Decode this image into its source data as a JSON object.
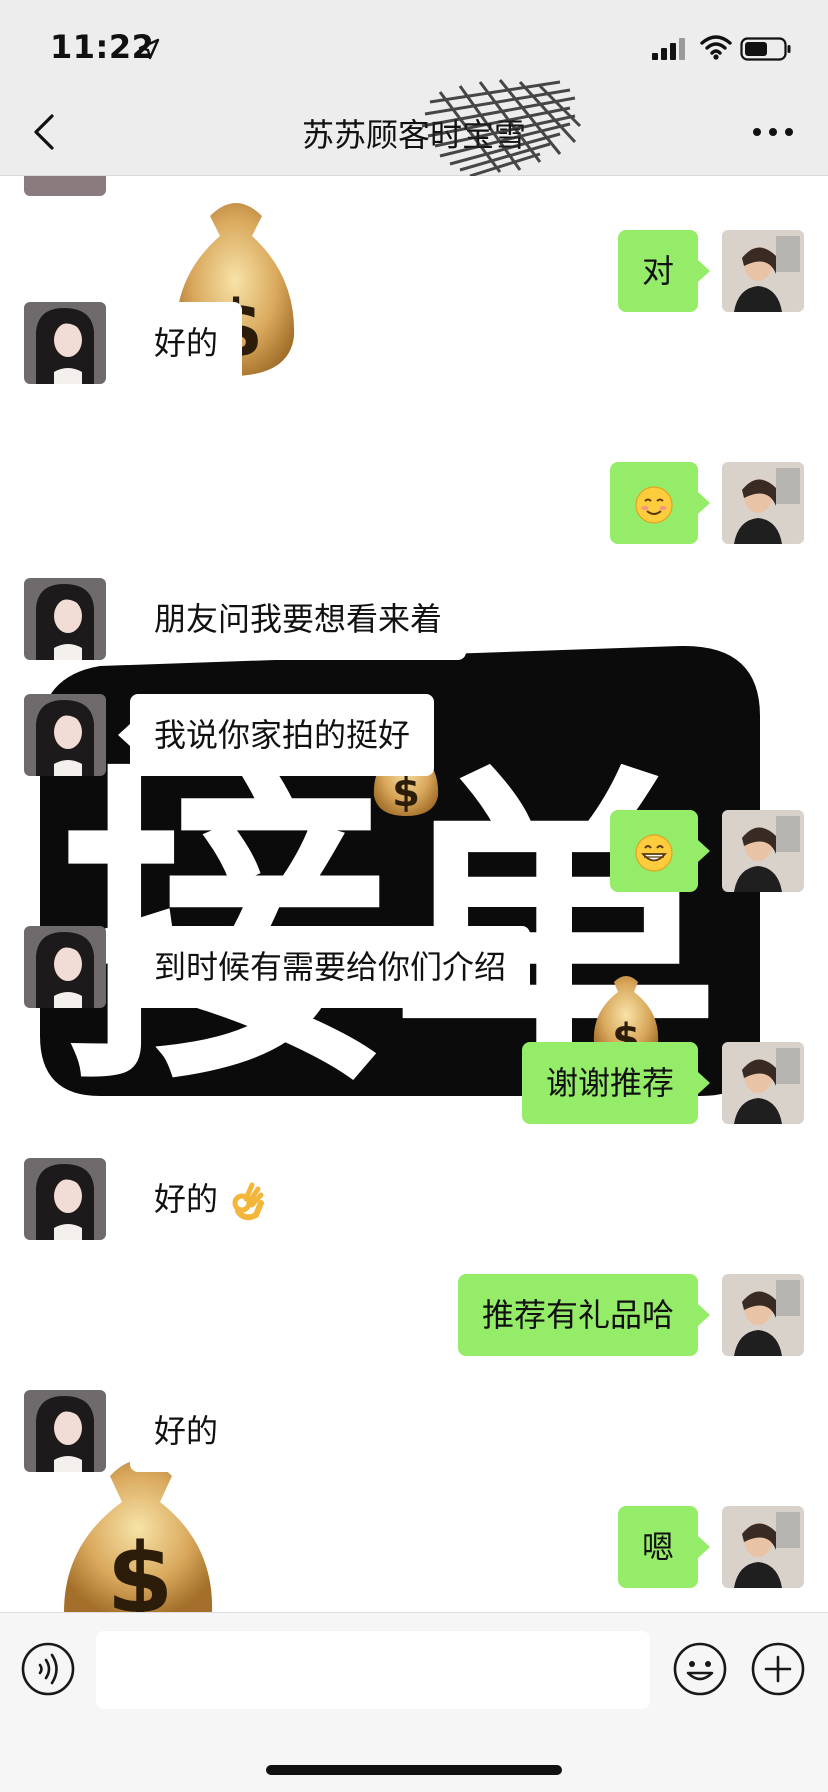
{
  "status_bar": {
    "time": "11:22",
    "icons": [
      "location-arrow-icon",
      "cellular-signal-icon",
      "wifi-icon",
      "battery-icon"
    ]
  },
  "header": {
    "title": "苏苏顾客时宝雪",
    "back_icon": "chevron-left-icon",
    "more_icon": "more-dots-icon"
  },
  "messages": [
    {
      "side": "out",
      "text": "对"
    },
    {
      "side": "in",
      "text": "好的"
    },
    {
      "side": "out",
      "text": "",
      "emoji": "smiling-face-emoji"
    },
    {
      "side": "in",
      "text": "朋友问我要想看来着"
    },
    {
      "side": "in",
      "text": "我说你家拍的挺好"
    },
    {
      "side": "out",
      "text": "",
      "emoji": "grinning-face-emoji"
    },
    {
      "side": "in",
      "text": "到时候有需要给你们介绍"
    },
    {
      "side": "out",
      "text": "谢谢推荐"
    },
    {
      "side": "in",
      "text": "好的",
      "emoji": "ok-hand-emoji"
    },
    {
      "side": "out",
      "text": "推荐有礼品哈"
    },
    {
      "side": "in",
      "text": "好的"
    },
    {
      "side": "out",
      "text": "嗯"
    }
  ],
  "sticker": {
    "text": "接单",
    "decorations": [
      "money-bag-emoji"
    ]
  },
  "input_bar": {
    "value": "",
    "icons": [
      "voice-icon",
      "emoji-face-icon",
      "plus-icon"
    ]
  },
  "colors": {
    "outgoing_bubble": "#95ec69",
    "incoming_bubble": "#ffffff",
    "header_bg": "#ededed",
    "chat_bg": "#ffffff"
  }
}
